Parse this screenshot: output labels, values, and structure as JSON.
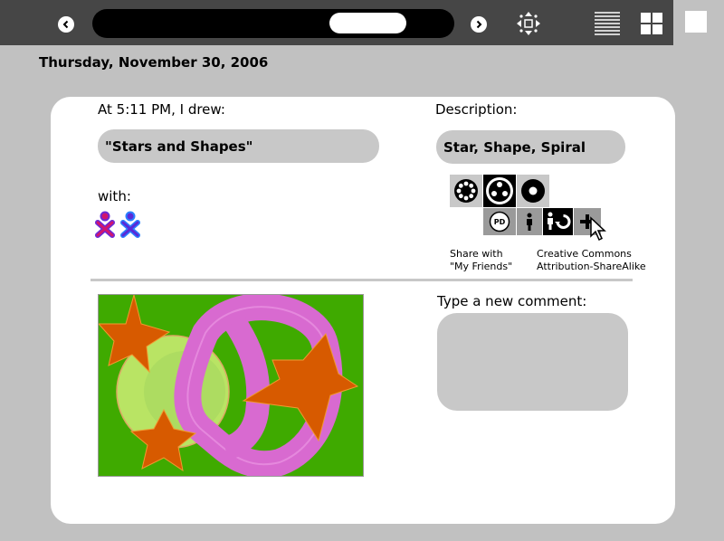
{
  "toolbar": {
    "back_icon": "chevron-left-icon",
    "forward_icon": "chevron-right-icon",
    "view_icons": [
      "move-icon",
      "list-view-icon",
      "grid-view-icon",
      "home-view-icon"
    ]
  },
  "journal": {
    "date": "Thursday, November 30, 2006",
    "drew_label": "At 5:11 PM, I drew:",
    "title_value": "\"Stars and Shapes\"",
    "description_label": "Description:",
    "description_value": "Star, Shape, Spiral",
    "with_label": "with:",
    "share_text_1": "Share with",
    "share_text_2": "\"My Friends\"",
    "license_text_1": "Creative Commons",
    "license_text_2": "Attribution-ShareAlike",
    "pd_text": "PD",
    "comment_label": "Type a new comment:"
  },
  "colors": {
    "toolbar_bg": "#464646",
    "page_bg": "#c1c1c1",
    "field_bg": "#c8c8c8",
    "drawing_bg": "#3faa00",
    "star_color": "#d75a00",
    "ribbon_color": "#d86ad0",
    "circle_color": "#c0e86a",
    "buddy_fill_1": "#d0156f",
    "buddy_stroke_1": "#6a2ad8",
    "buddy_fill_2": "#5a2ad8",
    "buddy_stroke_2": "#2a80ff"
  }
}
